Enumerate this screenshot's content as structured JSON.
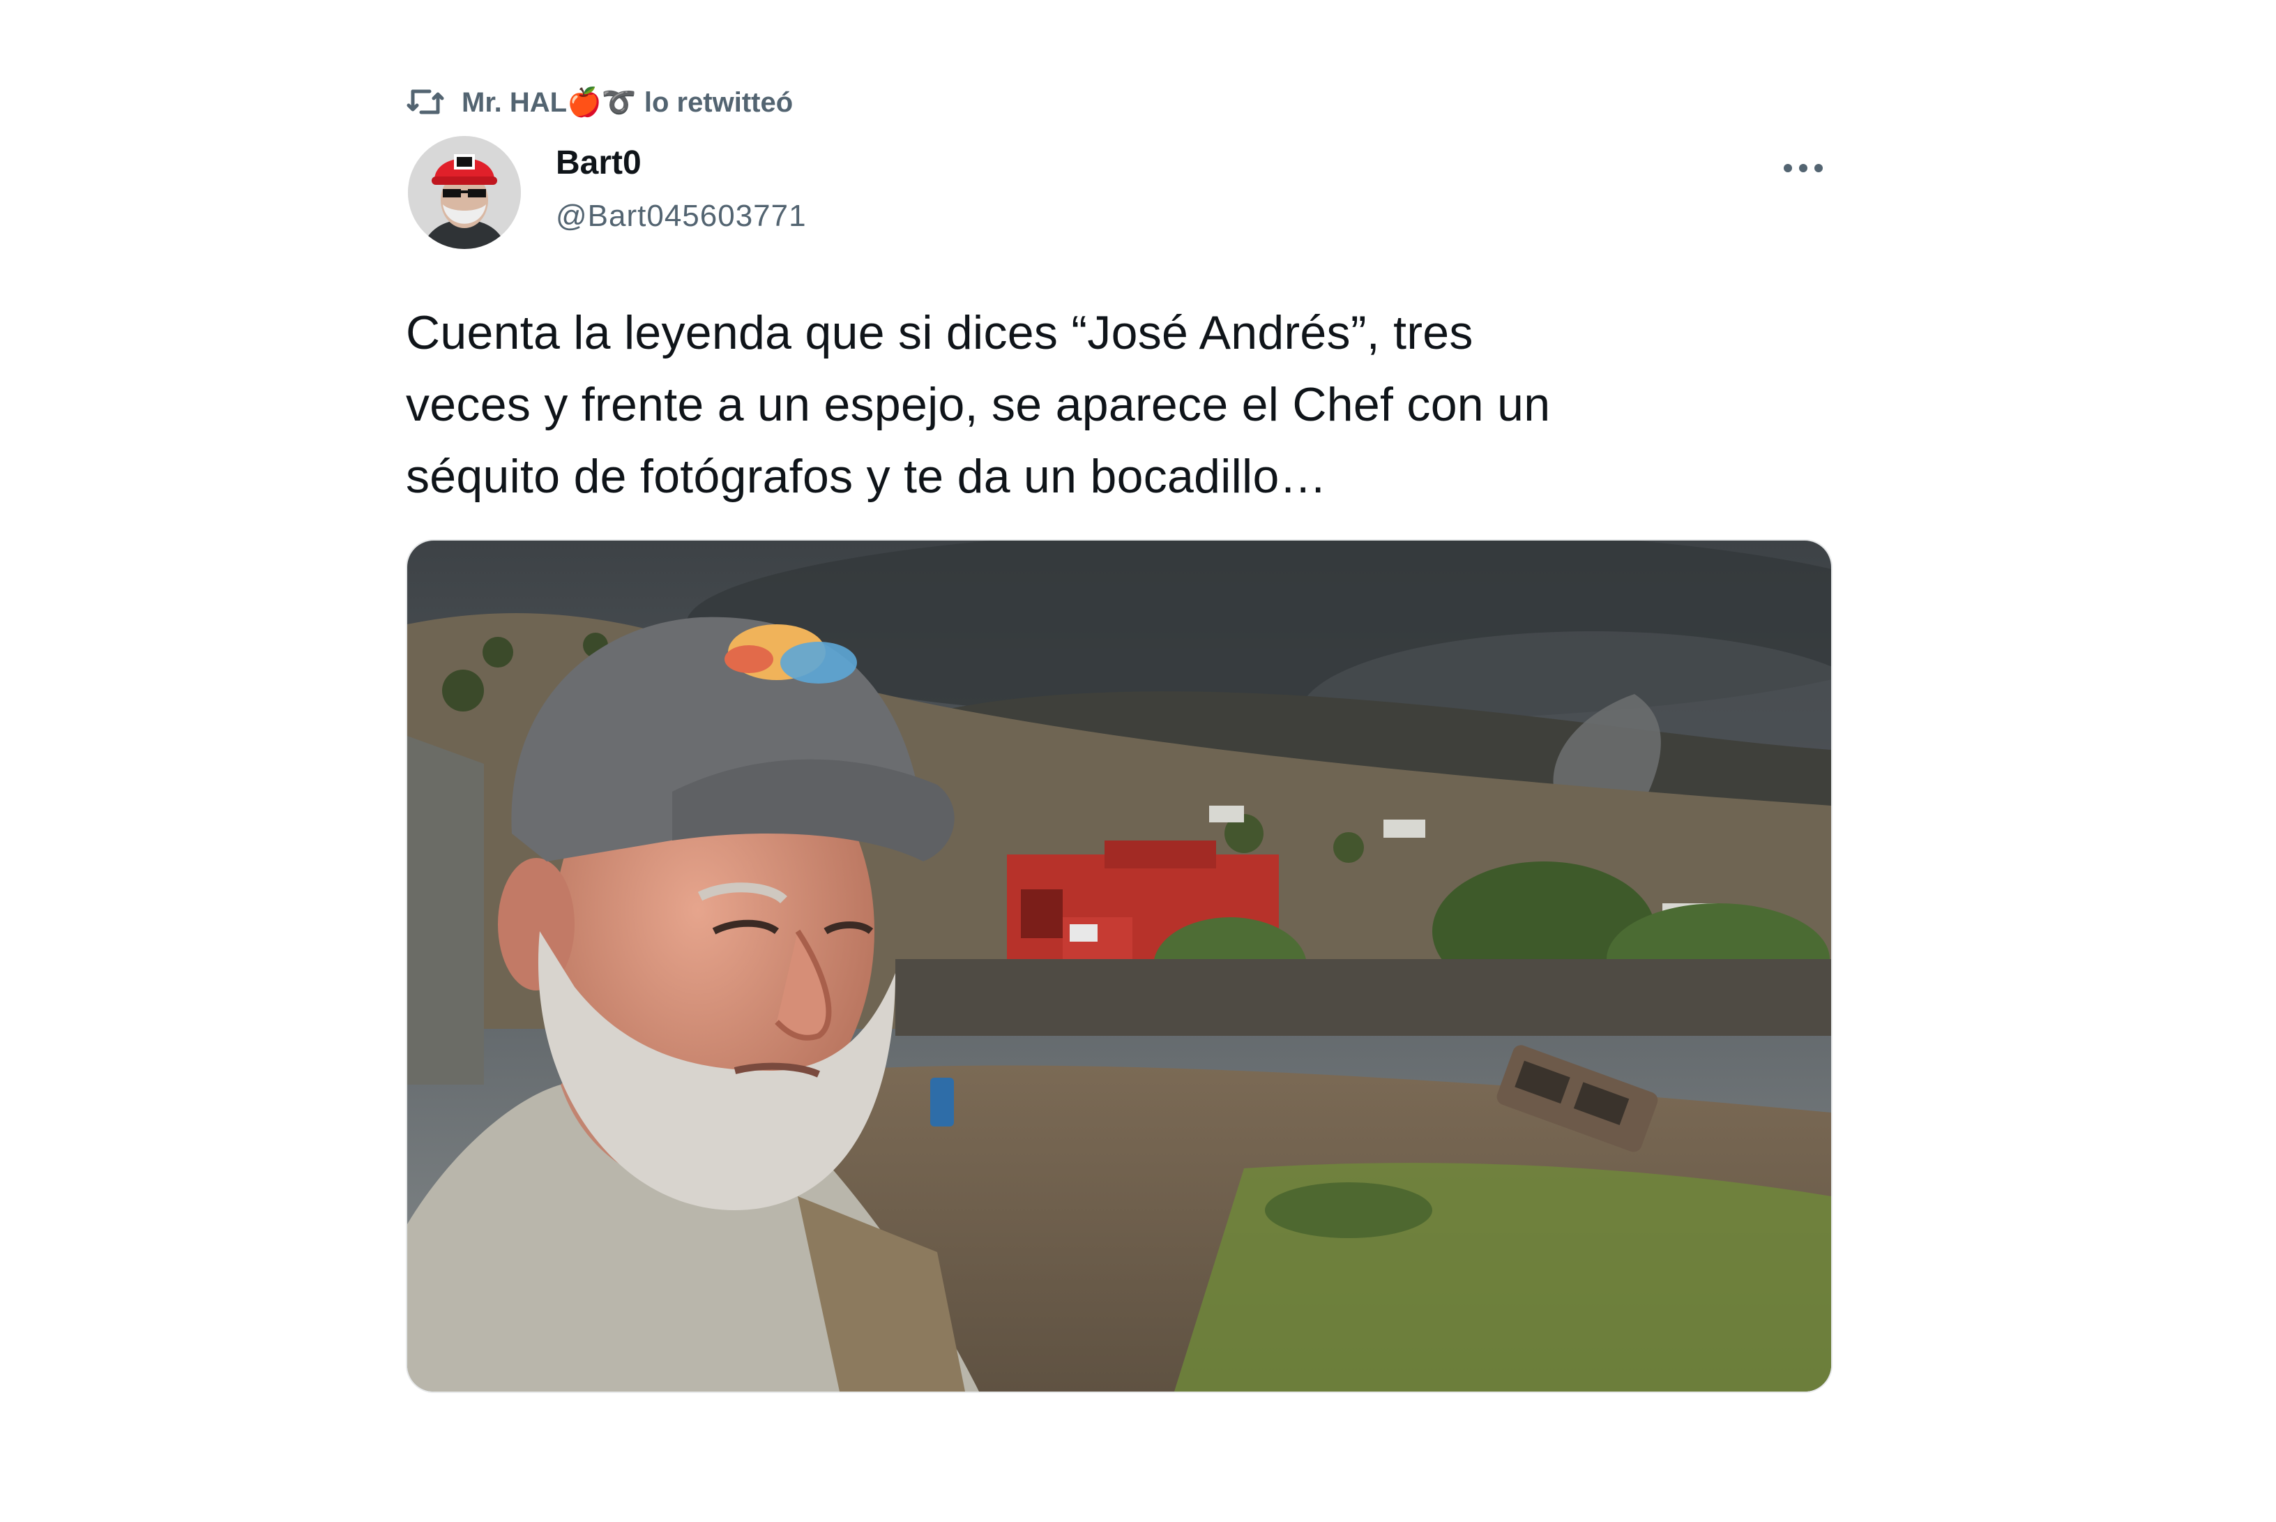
{
  "retweet": {
    "icon": "retweet-icon",
    "text": "Mr. HAL🍎➰ lo retwitteó"
  },
  "tweet": {
    "author": {
      "display_name": "Bart0",
      "handle": "@Bart045603771",
      "avatar": "avatar-image"
    },
    "more_icon": "more-options-icon",
    "text": "Cuenta la leyenda que si dices “José Andrés”, tres\nveces y frente a un espejo, se aparece el Chef con un\nséquito de fotógrafos y te da un bocadillo…",
    "media": "photo-man-in-cap-volcano-landscape"
  },
  "colors": {
    "text_primary": "#0f1419",
    "text_secondary": "#536471",
    "border": "#e7e9ea"
  }
}
